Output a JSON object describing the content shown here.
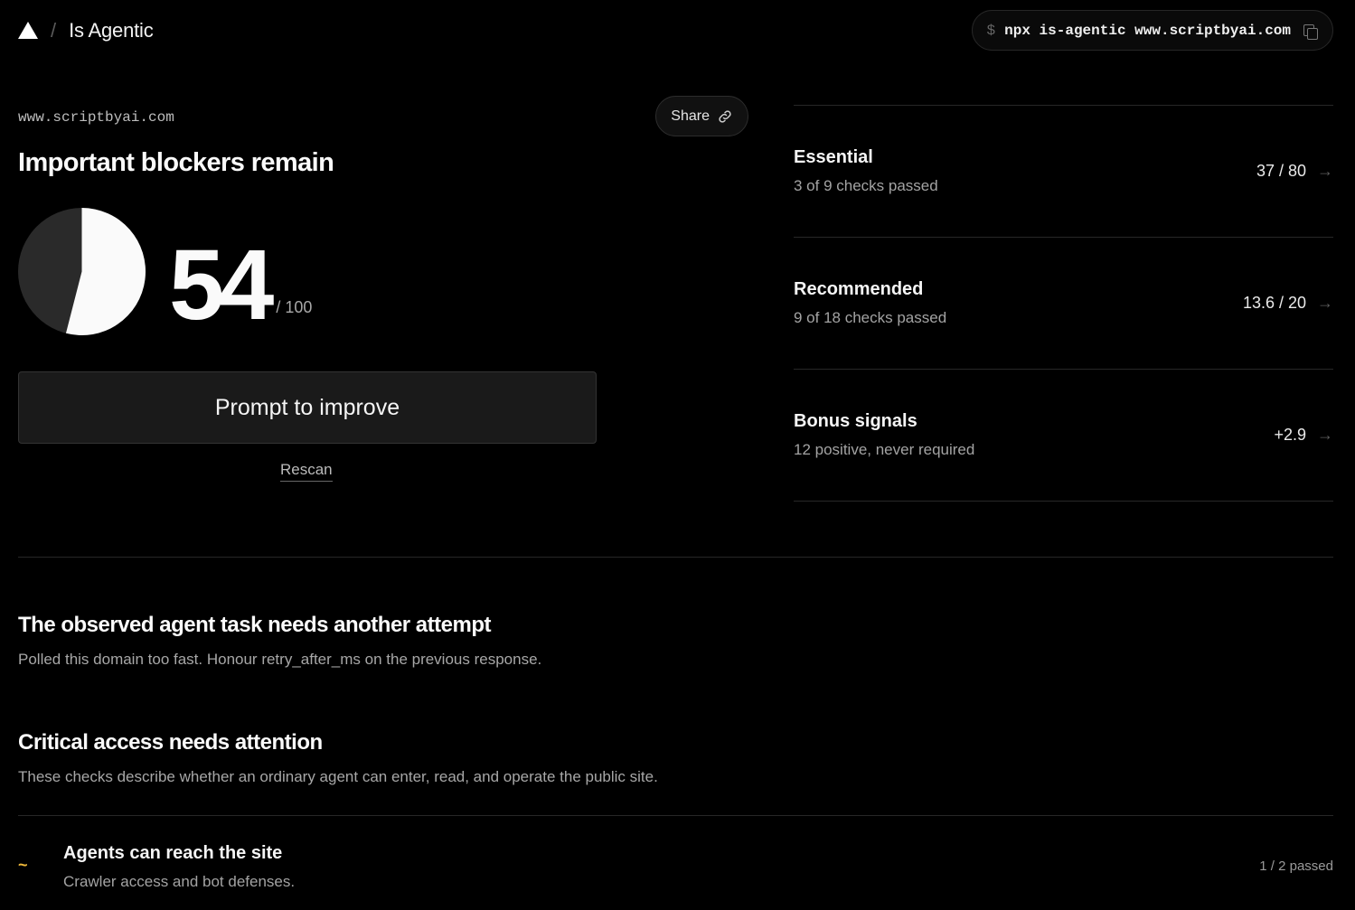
{
  "header": {
    "app_name": "Is Agentic",
    "separator": "/",
    "cmd_prompt": "$",
    "command": "npx is-agentic www.scriptbyai.com"
  },
  "report": {
    "domain": "www.scriptbyai.com",
    "share_label": "Share",
    "verdict": "Important blockers remain",
    "score": "54",
    "score_max": "/ 100",
    "score_fraction": 0.54,
    "prompt_button": "Prompt to improve",
    "rescan_label": "Rescan"
  },
  "categories": [
    {
      "name": "Essential",
      "summary": "3 of 9 checks passed",
      "score": "37 / 80"
    },
    {
      "name": "Recommended",
      "summary": "9 of 18 checks passed",
      "score": "13.6 / 20"
    },
    {
      "name": "Bonus signals",
      "summary": "12 positive, never required",
      "score": "+2.9"
    }
  ],
  "notice": {
    "title": "The observed agent task needs another attempt",
    "description": "Polled this domain too fast. Honour retry_after_ms on the previous response."
  },
  "critical": {
    "title": "Critical access needs attention",
    "description": "These checks describe whether an ordinary agent can enter, read, and operate the public site.",
    "checks": [
      {
        "status_symbol": "~",
        "title": "Agents can reach the site",
        "subtitle": "Crawler access and bot defenses.",
        "count": "1 / 2 passed"
      }
    ]
  },
  "colors": {
    "background": "#000000",
    "pie_filled": "#fafafa",
    "pie_empty": "#2a2a2a",
    "warning": "#f0b93a"
  },
  "icons": {
    "logo": "triangle-logo-icon",
    "copy": "copy-icon",
    "share": "link-icon",
    "row_arrow": "arrow-right-icon",
    "partial_status": "tilde-icon"
  }
}
